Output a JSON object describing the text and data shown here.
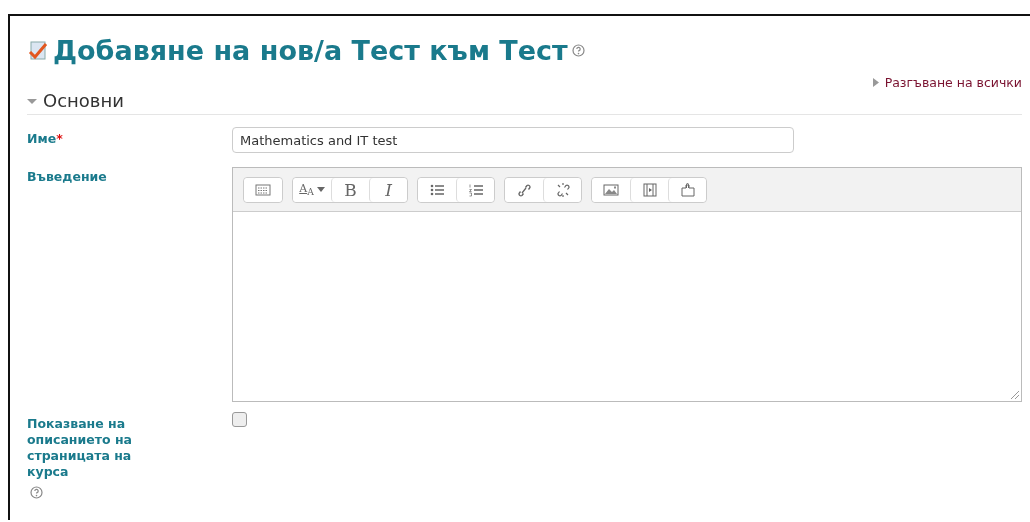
{
  "page": {
    "title": "Добавяне на нов/а Тест към Тест",
    "expand_all": "Разгъване на всички"
  },
  "section": {
    "title": "Основни",
    "expanded": true
  },
  "fields": [
    {
      "kind": "text",
      "label": "Име",
      "required_mark": "*",
      "value": "Mathematics and IT test"
    },
    {
      "kind": "editor",
      "label": "Въведение",
      "toolbar": [
        [
          {
            "kind": "icon"
          }
        ],
        [
          {
            "kind": "text",
            "text": "A$_{A}$"
          },
          {
            "kind": "text",
            "text": "B"
          },
          {
            "kind": "text",
            "text": "I"
          }
        ],
        [
          {
            "kind": "icon"
          },
          {
            "kind": "icon"
          }
        ],
        [
          {
            "kind": "icon"
          },
          {
            "kind": "icon"
          }
        ],
        [
          {
            "kind": "icon"
          },
          {
            "kind": "icon"
          },
          {
            "kind": "icon"
          }
        ]
      ]
    },
    {
      "kind": "checkbox",
      "label": "Показване на описанието на страницата на курса",
      "checked": false,
      "help": true
    }
  ]
}
